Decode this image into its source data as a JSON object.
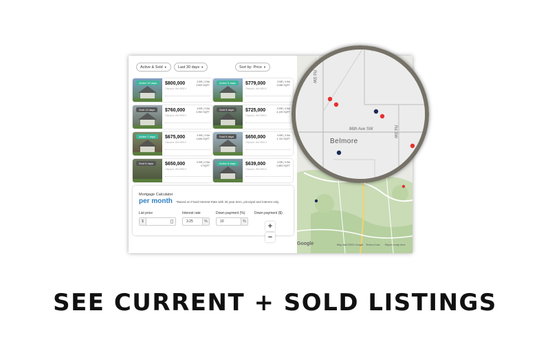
{
  "filters": {
    "status": "Active & Sold",
    "period": "Last 30 days",
    "sort": "Sort by: Price"
  },
  "listings": [
    {
      "tag": "Active 10 days",
      "tag_type": "active",
      "price": "$800,000",
      "beds_baths": "3 BR | 3 BA",
      "sqft": "3,500 SQFT",
      "address_line": "Olympia, WA 98513"
    },
    {
      "tag": "Active 5 days",
      "tag_type": "active",
      "price": "$779,000",
      "beds_baths": "3 BR | 4 BA",
      "sqft": "3,088 SQFT",
      "address_line": "Olympia, WA 98513"
    },
    {
      "tag": "Sold 13 days",
      "tag_type": "sold",
      "price": "$760,000",
      "beds_baths": "4 BR | 3 BA",
      "sqft": "2,952 SQFT",
      "address_line": "Olympia, WA 98513"
    },
    {
      "tag": "Sold 5 days",
      "tag_type": "sold",
      "price": "$725,000",
      "beds_baths": "5 BR | 4 BA",
      "sqft": "4,139 SQFT",
      "address_line": "Olympia, WA 98513"
    },
    {
      "tag": "Active 7 days",
      "tag_type": "active",
      "price": "$675,000",
      "beds_baths": "3 BR | 3 BA",
      "sqft": "1,696 SQFT",
      "address_line": "Olympia, WA 98513"
    },
    {
      "tag": "Sold 5 days",
      "tag_type": "sold",
      "price": "$650,000",
      "beds_baths": "4 BR | 3 BA",
      "sqft": "1,740 SQFT",
      "address_line": "Olympia, WA 98513"
    },
    {
      "tag": "Sold 6 days",
      "tag_type": "sold",
      "price": "$650,000",
      "beds_baths": "0 BR | 0 BA",
      "sqft": "0 SQFT",
      "address_line": "Olympia, WA 98513"
    },
    {
      "tag": "Active 8 days",
      "tag_type": "active",
      "price": "$639,000",
      "beds_baths": "4 BR | 3 BA",
      "sqft": "2,883 SQFT",
      "address_line": "Olympia, WA 98513"
    }
  ],
  "mortgage": {
    "title": "Mortgage Calculator",
    "per_month": "per month",
    "note": "*Based on Fixed Interest Rate with 30 year term, principal and interest only.",
    "list_price_label": "List price",
    "list_price_prefix": "$",
    "interest_label": "Interest rate",
    "interest_value": "3.25",
    "interest_suffix": "%",
    "down_pct_label": "Down payment (%)",
    "down_pct_value": "10",
    "down_pct_suffix": "%",
    "down_amt_label": "Down payment ($)"
  },
  "map": {
    "place_label": "Belmore",
    "road_label": "86th Ave SW",
    "road_label_2": "Rd SW",
    "road_label_3": "Rd SW",
    "zoom_in": "+",
    "zoom_out": "−",
    "attribution": "Map data ©2021 Google",
    "terms": "Terms of Use",
    "report": "Report a map error",
    "google": "Google"
  },
  "headline": "SEE CURRENT + SOLD LISTINGS",
  "colors": {
    "active_tag": "#3cb89a",
    "sold_tag": "#555555",
    "accent_blue": "#2f7fc1",
    "sold_marker": "#e63030",
    "active_marker": "#1c2a55"
  }
}
